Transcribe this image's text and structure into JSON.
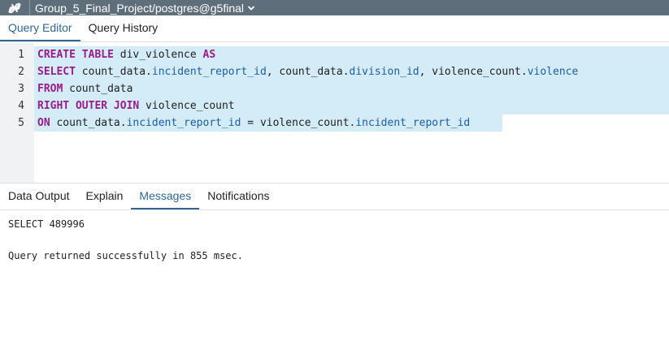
{
  "titlebar": {
    "connection_title": "Group_5_Final_Project/postgres@g5final",
    "icons": [
      "connection-icon",
      "chevron-down-icon"
    ]
  },
  "editor_tabs": {
    "query_editor": "Query Editor",
    "query_history": "Query History",
    "active": "Query Editor"
  },
  "editor": {
    "line_numbers": [
      "1",
      "2",
      "3",
      "4",
      "5"
    ],
    "lines": [
      [
        {
          "t": "CREATE TABLE",
          "c": "kw"
        },
        {
          "t": " div_violence ",
          "c": ""
        },
        {
          "t": "AS",
          "c": "kw"
        }
      ],
      [
        {
          "t": "SELECT",
          "c": "kw"
        },
        {
          "t": " count_data.",
          "c": ""
        },
        {
          "t": "incident_report_id",
          "c": "prop"
        },
        {
          "t": ", count_data.",
          "c": ""
        },
        {
          "t": "division_id",
          "c": "prop"
        },
        {
          "t": ", violence_count.",
          "c": ""
        },
        {
          "t": "violence",
          "c": "prop"
        }
      ],
      [
        {
          "t": "FROM",
          "c": "kw"
        },
        {
          "t": " count_data",
          "c": ""
        }
      ],
      [
        {
          "t": "RIGHT OUTER JOIN",
          "c": "kw"
        },
        {
          "t": " violence_count",
          "c": ""
        }
      ],
      [
        {
          "t": "ON",
          "c": "kw"
        },
        {
          "t": " count_data.",
          "c": ""
        },
        {
          "t": "incident_report_id",
          "c": "prop"
        },
        {
          "t": " = violence_count.",
          "c": ""
        },
        {
          "t": "incident_report_id",
          "c": "prop"
        }
      ]
    ],
    "colors": {
      "keyword": "#9a1c89",
      "property": "#1c5ea8",
      "selection": "#d4ebf8"
    }
  },
  "output_tabs": {
    "data_output": "Data Output",
    "explain": "Explain",
    "messages": "Messages",
    "notifications": "Notifications",
    "active": "Messages"
  },
  "messages": {
    "result": "SELECT 489996",
    "status": "Query returned successfully in 855 msec."
  },
  "colors": {
    "titlebar": "#5f6e7b",
    "accent": "#326690"
  }
}
